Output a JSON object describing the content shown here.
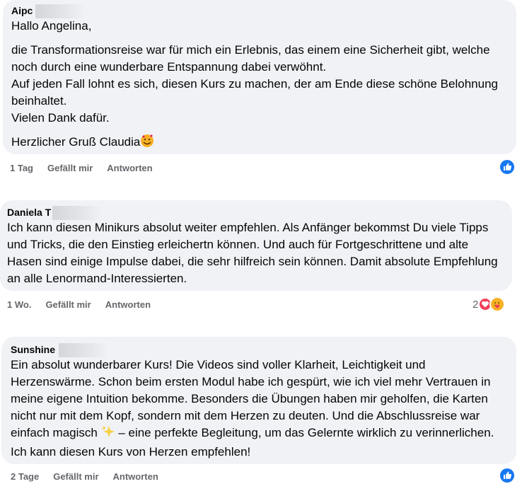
{
  "comments": [
    {
      "author": "Aipc",
      "paragraphs": [
        "Hallo Angelina,",
        "die Transformationsreise war für mich ein Erlebnis, das einem eine Sicherheit gibt, welche noch durch eine wunderbare Entspannung dabei verwöhnt.",
        "Auf jeden Fall lohnt es sich, diesen Kurs zu machen, der am Ende diese schöne Belohnung beinhaltet.",
        "Vielen Dank dafür.",
        "Herzlicher Gruß Claudia"
      ],
      "time": "1 Tag",
      "like": "Gefällt mir",
      "reply": "Antworten",
      "reaction": "like-icon"
    },
    {
      "author": "Daniela T",
      "paragraphs": [
        "Ich kann diesen Minikurs absolut weiter empfehlen. Als Anfänger bekommst Du viele Tipps und Tricks, die den Einstieg erleichertn können. Und auch für Fortgeschrittene und alte Hasen sind einige Impulse dabei, die sehr hilfreich sein können. Damit absolute Empfehlung an alle Lenormand-Interessierten."
      ],
      "time": "1 Wo.",
      "like": "Gefällt mir",
      "reply": "Antworten",
      "reaction_count": "2",
      "reaction": "heart-care-icons"
    },
    {
      "author": "Sunshine",
      "paragraphs": [
        "Ein absolut wunderbarer Kurs! Die Videos sind voller Klarheit, Leichtigkeit und Herzenswärme. Schon beim ersten Modul habe ich gespürt, wie ich viel mehr Vertrauen in meine eigene Intuition bekomme. Besonders die Übungen haben mir geholfen, die Karten nicht nur mit dem Kopf, sondern mit dem Herzen zu deuten. Und die Abschlussreise war einfach magisch",
        "– eine perfekte Begleitung, um das Gelernte wirklich zu verinnerlichen. Ich kann diesen Kurs von Herzen empfehlen!"
      ],
      "time": "2 Tage",
      "like": "Gefällt mir",
      "reply": "Antworten",
      "reaction": "like-icon"
    }
  ],
  "colors": {
    "bubble": "#f0f2f5",
    "meta": "#65676b",
    "like_blue": "#1877f2",
    "heart_red": "#f33e58"
  }
}
